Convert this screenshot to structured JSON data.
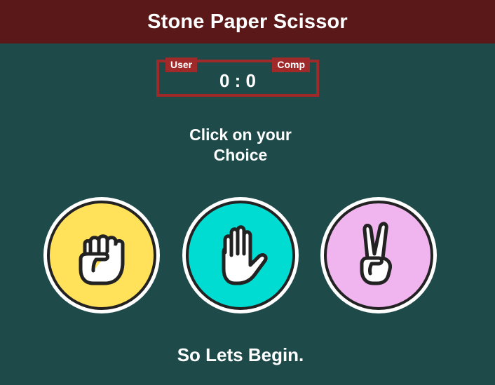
{
  "header": {
    "title": "Stone Paper Scissor"
  },
  "scoreboard": {
    "user_label": "User",
    "comp_label": "Comp",
    "score": "0 : 0",
    "user_score": 0,
    "comp_score": 0
  },
  "prompt": {
    "line1": "Click on your",
    "line2": "Choice"
  },
  "choices": [
    {
      "name": "stone",
      "icon": "fist-icon",
      "color": "#ffe15a"
    },
    {
      "name": "paper",
      "icon": "open-hand-icon",
      "color": "#00dcd2"
    },
    {
      "name": "scissor",
      "icon": "victory-hand-icon",
      "color": "#f0b4ee"
    }
  ],
  "message": "So Lets Begin.",
  "colors": {
    "background": "#1f4a4a",
    "header": "#5a1818",
    "score_accent": "#a02a2a"
  }
}
